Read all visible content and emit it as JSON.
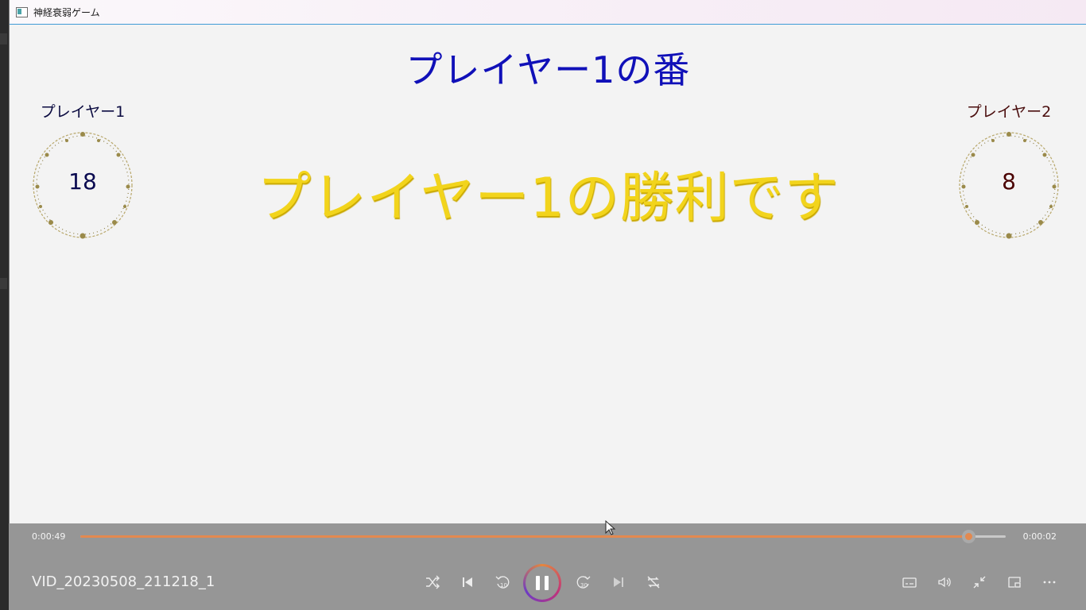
{
  "window": {
    "title": "神経衰弱ゲーム"
  },
  "game": {
    "turn_title": "プレイヤー1の番",
    "win_message": "プレイヤー1の勝利です",
    "players": [
      {
        "name": "プレイヤー1",
        "score": "18",
        "color": "#0a0a50"
      },
      {
        "name": "プレイヤー2",
        "score": "8",
        "color": "#4a0000"
      }
    ]
  },
  "media_player": {
    "video_title": "VID_20230508_211218_1",
    "time_elapsed": "0:00:49",
    "time_remaining": "0:00:02",
    "progress_fraction": 0.96,
    "accent_color": "#e3894f",
    "controls": [
      "shuffle-icon",
      "previous-icon",
      "rewind-10-icon",
      "pause-icon",
      "forward-30-icon",
      "next-icon",
      "repeat-off-icon"
    ],
    "right_controls": [
      "subtitles-icon",
      "volume-icon",
      "exit-fullscreen-icon",
      "mini-player-icon",
      "more-icon"
    ],
    "rewind_label": "10",
    "forward_label": "30"
  }
}
